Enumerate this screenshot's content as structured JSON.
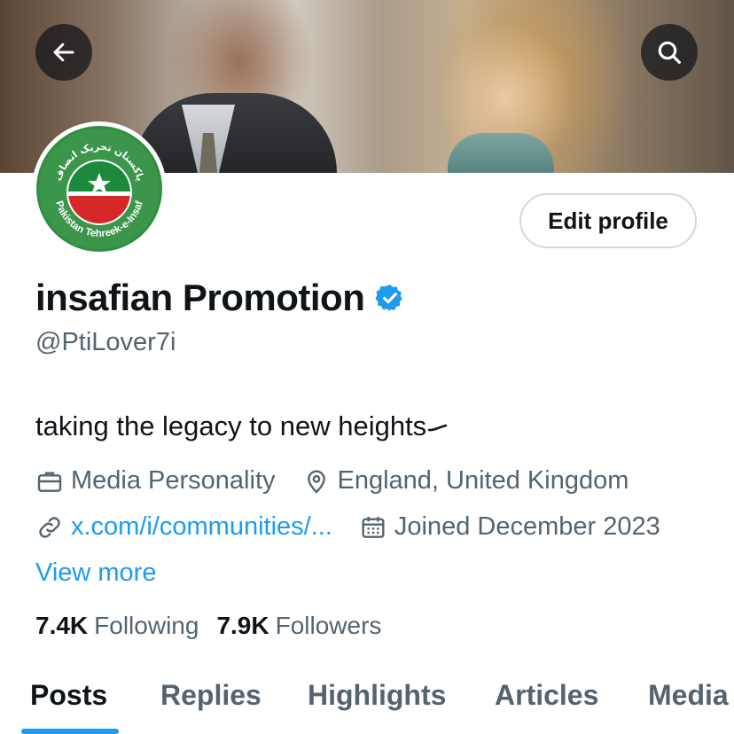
{
  "header": {
    "back_icon": "arrow-left-icon",
    "search_icon": "search-icon"
  },
  "avatar": {
    "logo_text_urdu": "پاکستان تحریک انصاف",
    "logo_text_english": "Pakistan Tehreek-e-Insaf",
    "colors": {
      "green": "#1c8a3a",
      "red": "#d62828",
      "ring": "#2f8f3f"
    }
  },
  "profile": {
    "edit_label": "Edit profile",
    "display_name": "insafian Promotion",
    "verified_icon": "verified-badge-icon",
    "handle": "@PtiLover7i",
    "bio": "taking the legacy to new heights"
  },
  "meta": {
    "category": {
      "icon": "briefcase-icon",
      "text": "Media Personality"
    },
    "location": {
      "icon": "location-pin-icon",
      "text": "England, United Kingdom"
    },
    "website": {
      "icon": "link-icon",
      "text": "x.com/i/communities/..."
    },
    "joined": {
      "icon": "calendar-icon",
      "text": "Joined December 2023"
    }
  },
  "view_more": "View more",
  "stats": {
    "following": {
      "count": "7.4K",
      "label": "Following"
    },
    "followers": {
      "count": "7.9K",
      "label": "Followers"
    }
  },
  "tabs": [
    {
      "label": "Posts",
      "active": true
    },
    {
      "label": "Replies",
      "active": false
    },
    {
      "label": "Highlights",
      "active": false
    },
    {
      "label": "Articles",
      "active": false
    },
    {
      "label": "Media",
      "active": false
    }
  ],
  "colors": {
    "accent": "#1d9bf0",
    "text_primary": "#0f1419",
    "text_secondary": "#536471",
    "border": "#cfd9de"
  }
}
